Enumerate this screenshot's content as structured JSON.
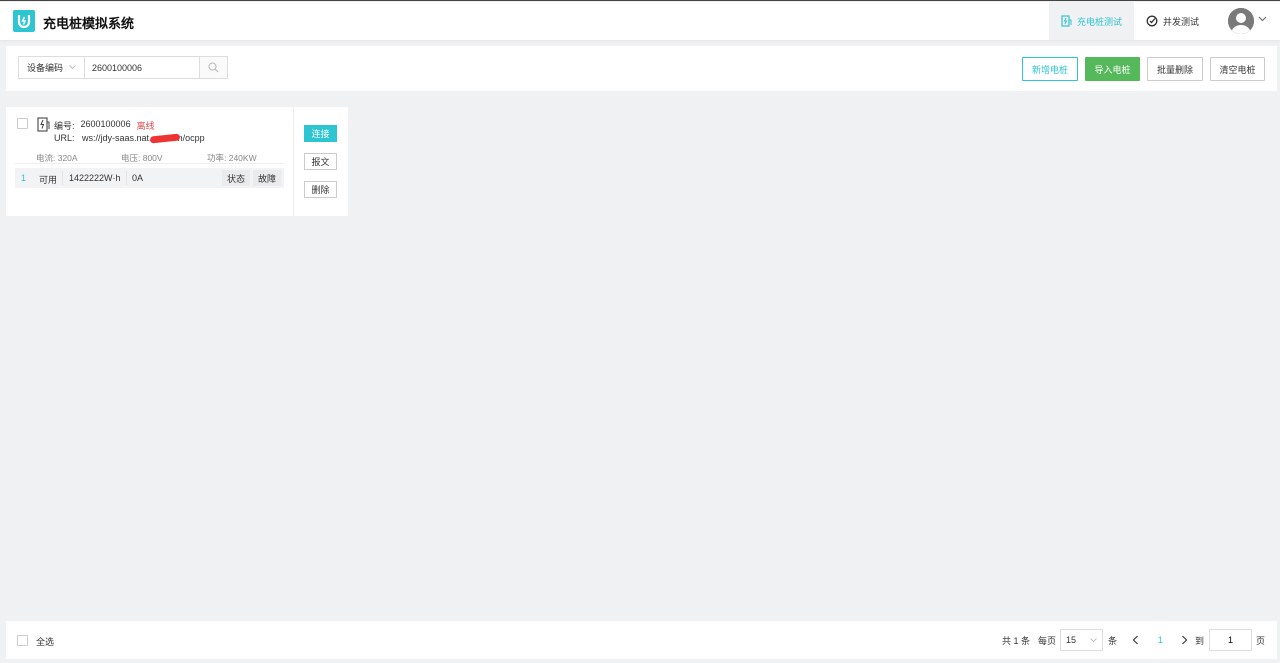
{
  "app": {
    "title": "充电桩模拟系统"
  },
  "nav": {
    "pile_test": "充电桩测试",
    "concurrency_test": "并发测试"
  },
  "search": {
    "field_select": "设备编码",
    "value": "2600100006"
  },
  "toolbar": {
    "add_label": "新增电桩",
    "import_label": "导入电桩",
    "batch_delete_label": "批量删除",
    "clear_label": "清空电桩"
  },
  "pile": {
    "code_label": "编号:",
    "code": "2600100006",
    "status": "离线",
    "url_label": "URL:",
    "url_prefix": "ws://jdy-saas.nat.",
    "url_suffix": "n/ocpp",
    "current": "电流:  320A",
    "voltage": "电压:  800V",
    "power": "功率:  240KW",
    "connector": {
      "index": "1",
      "status": "可用",
      "energy": "1422222W·h",
      "current": "0A",
      "state_btn": "状态",
      "fault_btn": "故障"
    },
    "connect_btn": "连接",
    "message_btn": "报文",
    "delete_btn": "删除"
  },
  "footer": {
    "select_all": "全选",
    "total": "共 1 条",
    "per_page": "每页",
    "page_size": "15",
    "unit": "条",
    "current_page": "1",
    "goto": "到",
    "jump_value": "1",
    "page_unit": "页"
  },
  "colors": {
    "accent": "#2ec5d3",
    "import_green": "#55b85a",
    "offline_red": "#e34a4a"
  }
}
